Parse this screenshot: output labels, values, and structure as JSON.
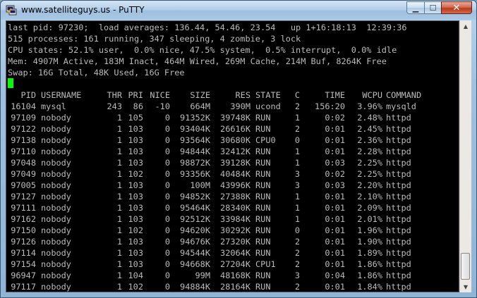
{
  "window": {
    "title": "www.satelliteguys.us - PuTTY"
  },
  "header_lines": [
    "last pid: 97230;  load averages: 136.44, 54.46, 23.54   up 1+16:18:13  12:39:36",
    "515 processes: 161 running, 347 sleeping, 4 zombie, 3 lock",
    "CPU states: 52.1% user,  0.0% nice, 47.5% system,  0.5% interrupt,  0.0% idle",
    "Mem: 4907M Active, 183M Inact, 464M Wired, 269M Cache, 214M Buf, 8264K Free",
    "Swap: 16G Total, 48K Used, 16G Free"
  ],
  "table": {
    "columns": [
      "PID",
      "USERNAME",
      "THR",
      "PRI",
      "NICE",
      "SIZE",
      "RES",
      "STATE",
      "C",
      "TIME",
      "WCPU",
      "COMMAND"
    ],
    "rows": [
      [
        "16104",
        "mysql",
        "243",
        "86",
        "-10",
        "664M",
        "390M",
        "ucond",
        "2",
        "156:20",
        "3.96%",
        "mysqld"
      ],
      [
        "97109",
        "nobody",
        "1",
        "105",
        "0",
        "91352K",
        "39748K",
        "RUN",
        "1",
        "0:02",
        "2.48%",
        "httpd"
      ],
      [
        "97122",
        "nobody",
        "1",
        "103",
        "0",
        "93404K",
        "26616K",
        "RUN",
        "2",
        "0:01",
        "2.45%",
        "httpd"
      ],
      [
        "97138",
        "nobody",
        "1",
        "103",
        "0",
        "93564K",
        "30680K",
        "CPU0",
        "0",
        "0:01",
        "2.36%",
        "httpd"
      ],
      [
        "97110",
        "nobody",
        "1",
        "103",
        "0",
        "94844K",
        "32412K",
        "RUN",
        "1",
        "0:01",
        "2.28%",
        "httpd"
      ],
      [
        "97048",
        "nobody",
        "1",
        "103",
        "0",
        "98872K",
        "39128K",
        "RUN",
        "1",
        "0:03",
        "2.25%",
        "httpd"
      ],
      [
        "97049",
        "nobody",
        "1",
        "102",
        "0",
        "93356K",
        "40484K",
        "RUN",
        "3",
        "0:02",
        "2.25%",
        "httpd"
      ],
      [
        "97005",
        "nobody",
        "1",
        "103",
        "0",
        "100M",
        "43996K",
        "RUN",
        "3",
        "0:03",
        "2.20%",
        "httpd"
      ],
      [
        "97127",
        "nobody",
        "1",
        "103",
        "0",
        "94852K",
        "27388K",
        "RUN",
        "1",
        "0:01",
        "2.10%",
        "httpd"
      ],
      [
        "97111",
        "nobody",
        "1",
        "103",
        "0",
        "95464K",
        "28340K",
        "RUN",
        "1",
        "0:01",
        "2.09%",
        "httpd"
      ],
      [
        "97162",
        "nobody",
        "1",
        "103",
        "0",
        "92512K",
        "33984K",
        "RUN",
        "1",
        "0:01",
        "2.01%",
        "httpd"
      ],
      [
        "97150",
        "nobody",
        "1",
        "102",
        "0",
        "94620K",
        "30292K",
        "RUN",
        "0",
        "0:01",
        "1.96%",
        "httpd"
      ],
      [
        "97126",
        "nobody",
        "1",
        "103",
        "0",
        "94676K",
        "27320K",
        "RUN",
        "2",
        "0:01",
        "1.90%",
        "httpd"
      ],
      [
        "97114",
        "nobody",
        "1",
        "103",
        "0",
        "94544K",
        "32064K",
        "RUN",
        "2",
        "0:01",
        "1.89%",
        "httpd"
      ],
      [
        "97154",
        "nobody",
        "1",
        "103",
        "0",
        "94668K",
        "27204K",
        "CPU1",
        "2",
        "0:01",
        "1.86%",
        "httpd"
      ],
      [
        "96947",
        "nobody",
        "1",
        "104",
        "0",
        "99M",
        "48168K",
        "RUN",
        "3",
        "0:04",
        "1.86%",
        "httpd"
      ],
      [
        "97117",
        "nobody",
        "1",
        "102",
        "0",
        "94884K",
        "28164K",
        "RUN",
        "2",
        "0:01",
        "1.84%",
        "httpd"
      ]
    ]
  },
  "colors": {
    "terminal_bg": "#000000",
    "terminal_fg": "#bbbbbb",
    "cursor": "#00ff00",
    "close_button": "#c4452a"
  },
  "icons": {
    "app": "putty-icon",
    "minimize": "minimize-icon",
    "maximize": "maximize-icon",
    "close": "close-icon",
    "scroll_up": "scroll-up-arrow-icon",
    "scroll_down": "scroll-down-arrow-icon"
  },
  "scrollbar": {
    "position_fraction": 0.95
  }
}
